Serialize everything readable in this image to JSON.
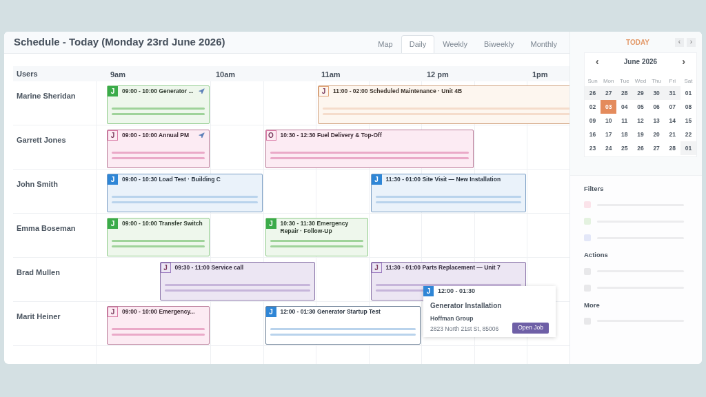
{
  "header": {
    "title": "Schedule - Today (Monday 23rd June 2026)",
    "tabs": [
      {
        "label": "Map",
        "selected": false
      },
      {
        "label": "Daily",
        "selected": true
      },
      {
        "label": "Weekly",
        "selected": false
      },
      {
        "label": "Biweekly",
        "selected": false
      },
      {
        "label": "Monthly",
        "selected": false
      }
    ]
  },
  "grid": {
    "users_heading": "Users",
    "hours": [
      "9am",
      "10am",
      "11am",
      "12 pm",
      "1pm"
    ],
    "rows": [
      {
        "user": "Marine Sheridan",
        "events": [
          {
            "badge": "J",
            "label": "09:00 - 10:00 Generator ...",
            "color": "#3bab4a",
            "navigation": true,
            "selected": false
          },
          {
            "badge": "J",
            "label": "11:00 - 02:00 Scheduled Maintenance · Unit 4B",
            "color": "#e0a57a",
            "navigation": false,
            "selected": false
          }
        ]
      },
      {
        "user": "Garrett Jones",
        "events": [
          {
            "badge": "J",
            "label": "09:00 - 10:00 Annual PM",
            "color": "#d97aa5",
            "navigation": true,
            "selected": false
          },
          {
            "badge": "O",
            "label": "10:30 - 12:30 Fuel Delivery & Top-Off",
            "color": "#d97aa5",
            "navigation": false,
            "selected": false
          }
        ]
      },
      {
        "user": "John Smith",
        "events": [
          {
            "badge": "J",
            "label": "09:00 - 10:30 Load Test · Building C",
            "color": "#2f86d6",
            "navigation": false,
            "selected": false
          },
          {
            "badge": "J",
            "label": "11:30 - 01:00 Site Visit — New Installation",
            "color": "#2f86d6",
            "navigation": false,
            "selected": false
          }
        ]
      },
      {
        "user": "Emma Boseman",
        "events": [
          {
            "badge": "J",
            "label": "09:00 - 10:00 Transfer Switch",
            "color": "#3bab4a",
            "navigation": false,
            "selected": false
          },
          {
            "badge": "J",
            "label": "10:30 - 11:30 Emergency Repair · Follow-Up",
            "color": "#3bab4a",
            "navigation": false,
            "selected": false
          }
        ]
      },
      {
        "user": "Brad Mullen",
        "events": [
          {
            "badge": "J",
            "label": "09:30 - 11:00 Service call",
            "color": "#9b7bc0",
            "navigation": false,
            "selected": false
          },
          {
            "badge": "J",
            "label": "11:30 - 01:00 Parts Replacement — Unit 7",
            "color": "#9b7bc0",
            "navigation": false,
            "selected": false
          }
        ]
      },
      {
        "user": "Marit Heiner",
        "events": [
          {
            "badge": "J",
            "label": "09:00 - 10:00 Emergency...",
            "color": "#d97aa5",
            "navigation": false,
            "selected": false
          },
          {
            "badge": "J",
            "label": "12:00 - 01:30 Generator Startup Test",
            "color": "#2f86d6",
            "navigation": false,
            "selected": true
          }
        ]
      }
    ]
  },
  "popover": {
    "badge": "J",
    "color": "#2f86d6",
    "time": "12:00 - 01:30",
    "title": "Generator Installation",
    "customer": "Hoffman Group",
    "address": "2823 North 21st St, 85006",
    "button": "Open Job"
  },
  "sidebar": {
    "today": "TODAY",
    "prev": "‹",
    "next": "›",
    "calendar": {
      "prev": "‹",
      "month": "June 2026",
      "next": "›",
      "weekdays": [
        "Sun",
        "Mon",
        "Tue",
        "Wed",
        "Thu",
        "Fri",
        "Sat"
      ],
      "weeks": [
        [
          {
            "day": "26",
            "outside": true,
            "selected": false
          },
          {
            "day": "27",
            "outside": true,
            "selected": false
          },
          {
            "day": "28",
            "outside": true,
            "selected": false
          },
          {
            "day": "29",
            "outside": true,
            "selected": false
          },
          {
            "day": "30",
            "outside": true,
            "selected": false
          },
          {
            "day": "31",
            "outside": true,
            "selected": false
          },
          {
            "day": "01",
            "outside": false,
            "selected": false
          }
        ],
        [
          {
            "day": "02",
            "outside": false,
            "selected": false
          },
          {
            "day": "03",
            "outside": false,
            "selected": true
          },
          {
            "day": "04",
            "outside": false,
            "selected": false
          },
          {
            "day": "05",
            "outside": false,
            "selected": false
          },
          {
            "day": "06",
            "outside": false,
            "selected": false
          },
          {
            "day": "07",
            "outside": false,
            "selected": false
          },
          {
            "day": "08",
            "outside": false,
            "selected": false
          }
        ],
        [
          {
            "day": "09",
            "outside": false,
            "selected": false
          },
          {
            "day": "10",
            "outside": false,
            "selected": false
          },
          {
            "day": "11",
            "outside": false,
            "selected": false
          },
          {
            "day": "12",
            "outside": false,
            "selected": false
          },
          {
            "day": "13",
            "outside": false,
            "selected": false
          },
          {
            "day": "14",
            "outside": false,
            "selected": false
          },
          {
            "day": "15",
            "outside": false,
            "selected": false
          }
        ],
        [
          {
            "day": "16",
            "outside": false,
            "selected": false
          },
          {
            "day": "17",
            "outside": false,
            "selected": false
          },
          {
            "day": "18",
            "outside": false,
            "selected": false
          },
          {
            "day": "19",
            "outside": false,
            "selected": false
          },
          {
            "day": "20",
            "outside": false,
            "selected": false
          },
          {
            "day": "21",
            "outside": false,
            "selected": false
          },
          {
            "day": "22",
            "outside": false,
            "selected": false
          }
        ],
        [
          {
            "day": "23",
            "outside": false,
            "selected": false
          },
          {
            "day": "24",
            "outside": false,
            "selected": false
          },
          {
            "day": "25",
            "outside": false,
            "selected": false
          },
          {
            "day": "26",
            "outside": false,
            "selected": false
          },
          {
            "day": "27",
            "outside": false,
            "selected": false
          },
          {
            "day": "28",
            "outside": false,
            "selected": false
          },
          {
            "day": "01",
            "outside": true,
            "selected": false
          }
        ]
      ]
    },
    "sections": [
      {
        "title": "Filters",
        "items": [
          {
            "color": "#fbe3ea"
          },
          {
            "color": "#e4f2e0"
          },
          {
            "color": "#e3e7f8"
          }
        ]
      },
      {
        "title": "Actions",
        "items": [
          {
            "color": "#e8e8ea"
          },
          {
            "color": "#e8e8ea"
          }
        ]
      },
      {
        "title": "More",
        "items": [
          {
            "color": "#e8e8ea"
          }
        ]
      }
    ]
  }
}
